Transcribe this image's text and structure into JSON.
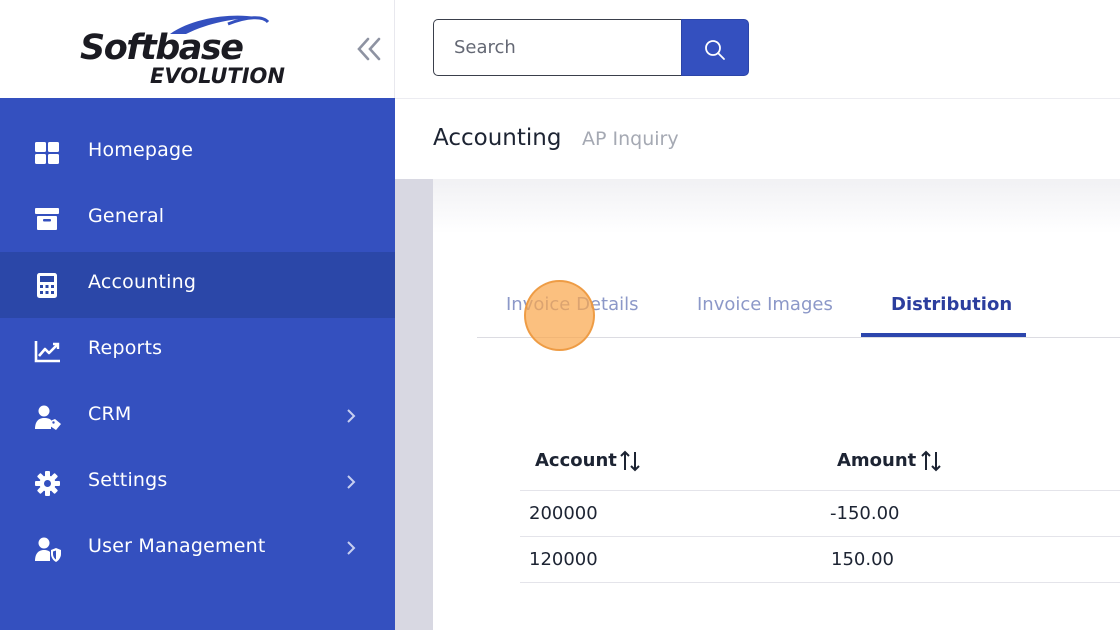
{
  "logo": {
    "line1": "Softbase",
    "line2": "EVOLUTION"
  },
  "search": {
    "placeholder": "Search"
  },
  "sidebar": {
    "items": [
      {
        "label": "Homepage",
        "icon": "grid-icon"
      },
      {
        "label": "General",
        "icon": "archive-icon"
      },
      {
        "label": "Accounting",
        "icon": "calculator-icon",
        "active": true
      },
      {
        "label": "Reports",
        "icon": "chart-line-icon"
      },
      {
        "label": "CRM",
        "icon": "user-tag-icon",
        "has_submenu": true
      },
      {
        "label": "Settings",
        "icon": "gear-icon",
        "has_submenu": true
      },
      {
        "label": "User Management",
        "icon": "user-shield-icon",
        "has_submenu": true
      }
    ]
  },
  "breadcrumb": {
    "main": "Accounting",
    "sub": "AP Inquiry"
  },
  "tabs": [
    {
      "label": "Invoice Details"
    },
    {
      "label": "Invoice Images"
    },
    {
      "label": "Distribution",
      "active": true
    }
  ],
  "table": {
    "headers": [
      "Account",
      "Amount"
    ],
    "rows": [
      [
        "200000",
        "-150.00"
      ],
      [
        "120000",
        "150.00"
      ]
    ]
  },
  "colors": {
    "sidebar": "#3450bf",
    "sidebar_active": "#2b47a8",
    "accent": "#2c46ad",
    "click_marker": "#f9a84e"
  }
}
